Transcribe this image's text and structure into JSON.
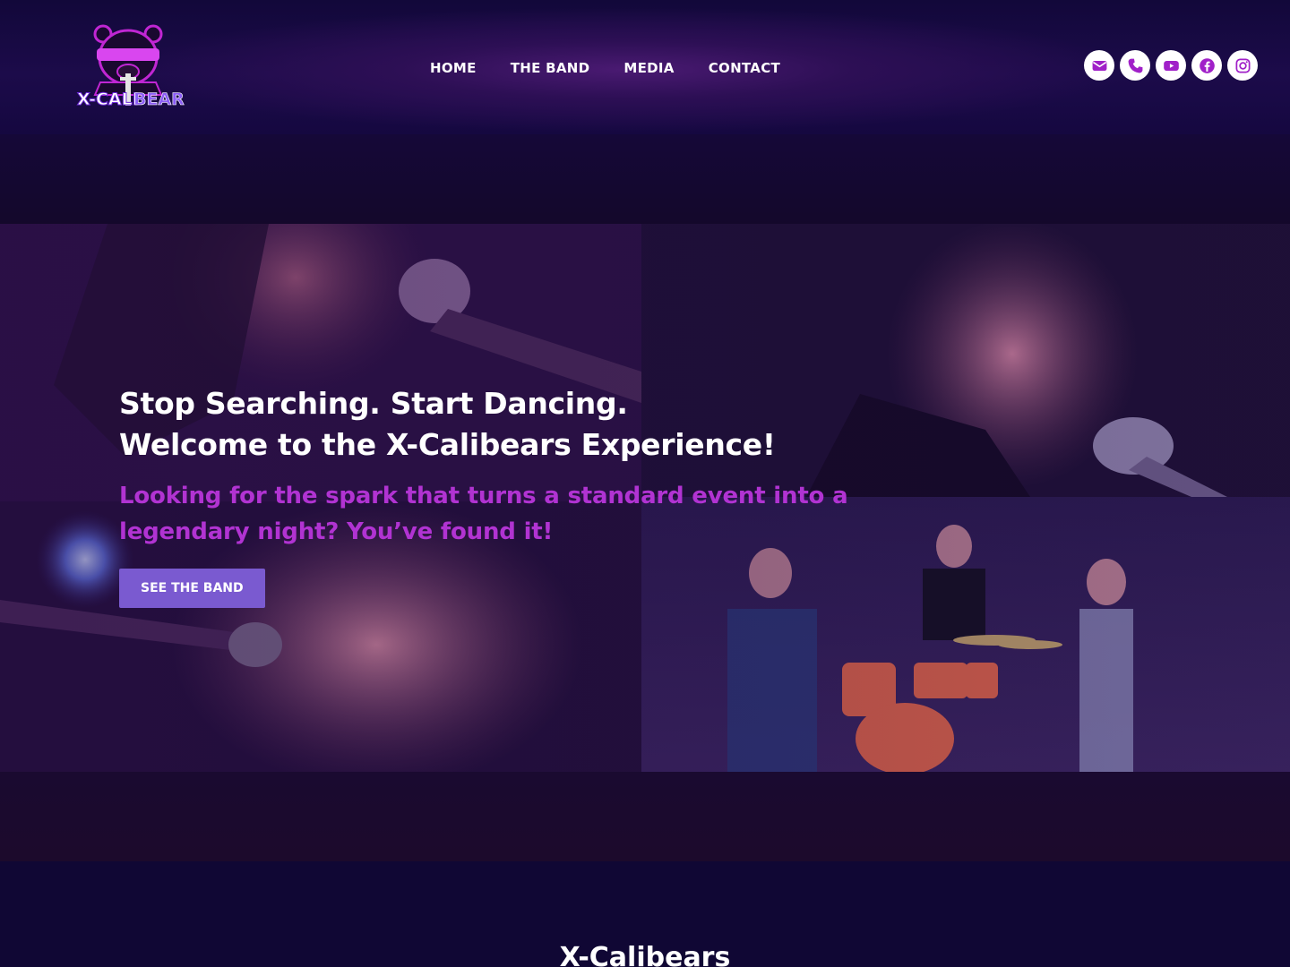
{
  "header": {
    "logo_text_left": "X-CALI",
    "logo_text_right": "BEARS",
    "nav": [
      {
        "label": "HOME"
      },
      {
        "label": "THE BAND"
      },
      {
        "label": "MEDIA"
      },
      {
        "label": "CONTACT"
      }
    ],
    "social": [
      {
        "icon": "envelope-icon"
      },
      {
        "icon": "phone-icon"
      },
      {
        "icon": "youtube-icon"
      },
      {
        "icon": "facebook-icon"
      },
      {
        "icon": "instagram-icon"
      }
    ]
  },
  "hero": {
    "title_line1": "Stop Searching. Start Dancing.",
    "title_line2": "Welcome to the X-Calibears Experience!",
    "subtitle": "Looking for the spark that turns a standard event into a legendary night? You’ve found it!",
    "button_label": "SEE THE BAND"
  },
  "lower": {
    "title": "X-Calibears"
  },
  "colors": {
    "accent_purple": "#b133d2",
    "button_purple": "#7a5ad0",
    "icon_purple": "#a020c8",
    "background": "#0e0629"
  }
}
